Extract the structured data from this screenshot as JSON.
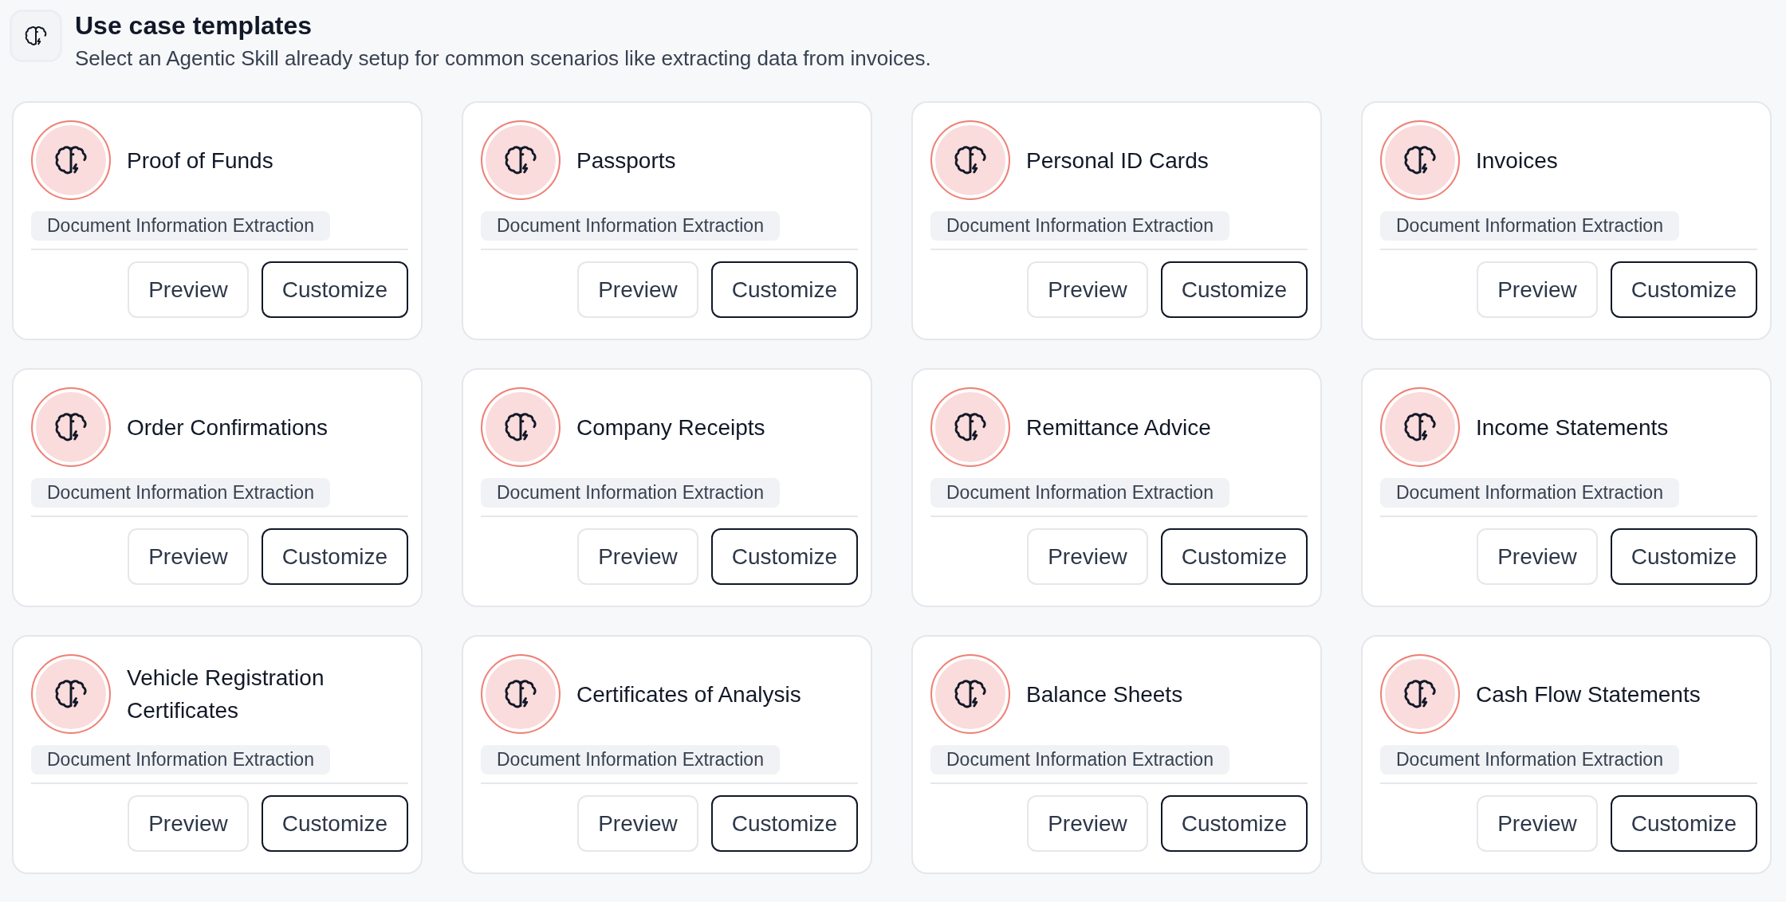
{
  "header": {
    "title": "Use case templates",
    "subtitle": "Select an Agentic Skill already setup for common scenarios like extracting data from invoices."
  },
  "templates": [
    {
      "title": "Proof of Funds",
      "tag": "Document Information Extraction",
      "buttons": [
        {
          "label": "Preview",
          "kind": "secondary"
        },
        {
          "label": "Customize",
          "kind": "primary"
        }
      ]
    },
    {
      "title": "Passports",
      "tag": "Document Information Extraction",
      "buttons": [
        {
          "label": "Preview",
          "kind": "secondary"
        },
        {
          "label": "Customize",
          "kind": "primary"
        }
      ]
    },
    {
      "title": "Personal ID Cards",
      "tag": "Document Information Extraction",
      "buttons": [
        {
          "label": "Preview",
          "kind": "secondary"
        },
        {
          "label": "Customize",
          "kind": "primary"
        }
      ]
    },
    {
      "title": "Invoices",
      "tag": "Document Information Extraction",
      "buttons": [
        {
          "label": "Preview",
          "kind": "secondary"
        },
        {
          "label": "Customize",
          "kind": "primary"
        }
      ]
    },
    {
      "title": "Order Confirmations",
      "tag": "Document Information Extraction",
      "buttons": [
        {
          "label": "Preview",
          "kind": "secondary"
        },
        {
          "label": "Customize",
          "kind": "primary"
        }
      ]
    },
    {
      "title": "Company Receipts",
      "tag": "Document Information Extraction",
      "buttons": [
        {
          "label": "Preview",
          "kind": "secondary"
        },
        {
          "label": "Customize",
          "kind": "primary"
        }
      ]
    },
    {
      "title": "Remittance Advice",
      "tag": "Document Information Extraction",
      "buttons": [
        {
          "label": "Preview",
          "kind": "secondary"
        },
        {
          "label": "Customize",
          "kind": "primary"
        }
      ]
    },
    {
      "title": "Income Statements",
      "tag": "Document Information Extraction",
      "buttons": [
        {
          "label": "Preview",
          "kind": "secondary"
        },
        {
          "label": "Customize",
          "kind": "primary"
        }
      ]
    },
    {
      "title": "Vehicle Registration Certificates",
      "tag": "Document Information Extraction",
      "buttons": [
        {
          "label": "Preview",
          "kind": "secondary"
        },
        {
          "label": "Customize",
          "kind": "primary"
        }
      ]
    },
    {
      "title": "Certificates of Analysis",
      "tag": "Document Information Extraction",
      "buttons": [
        {
          "label": "Preview",
          "kind": "secondary"
        },
        {
          "label": "Customize",
          "kind": "primary"
        }
      ]
    },
    {
      "title": "Balance Sheets",
      "tag": "Document Information Extraction",
      "buttons": [
        {
          "label": "Preview",
          "kind": "secondary"
        },
        {
          "label": "Customize",
          "kind": "primary"
        }
      ]
    },
    {
      "title": "Cash Flow Statements",
      "tag": "Document Information Extraction",
      "buttons": [
        {
          "label": "Preview",
          "kind": "secondary"
        },
        {
          "label": "Customize",
          "kind": "primary"
        }
      ]
    }
  ]
}
